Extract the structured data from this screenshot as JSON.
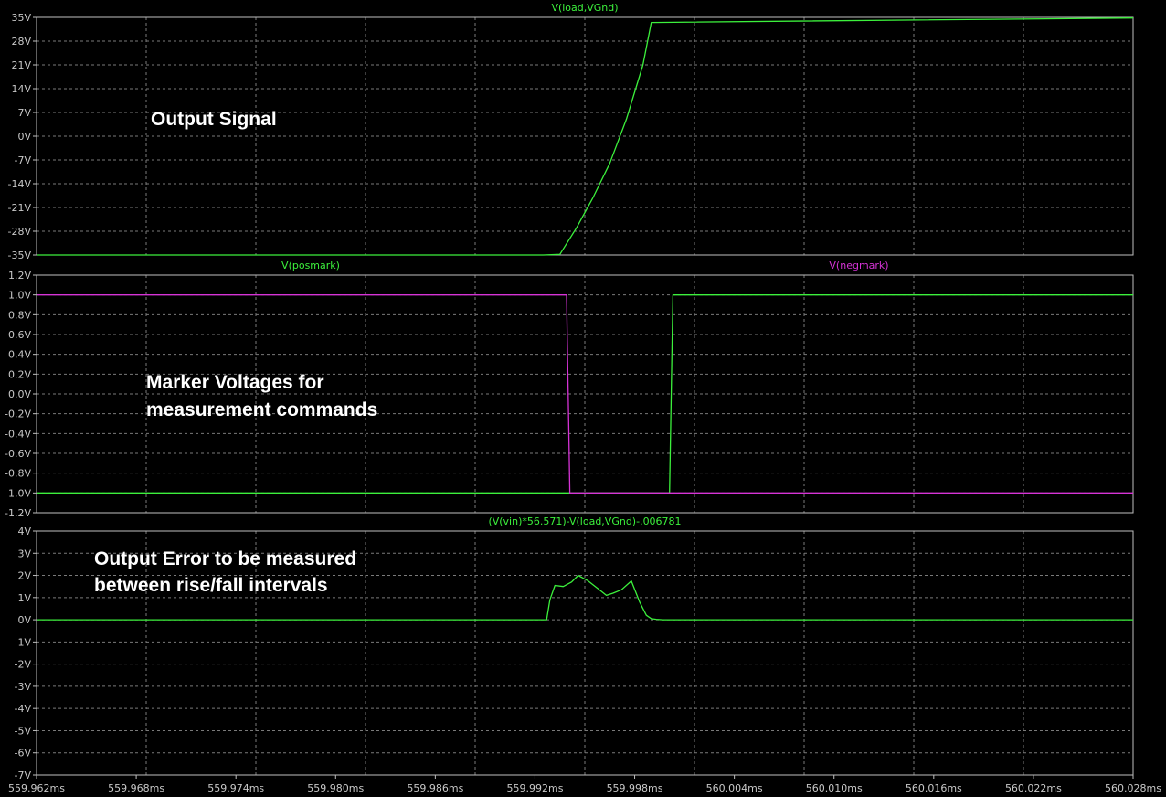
{
  "colors": {
    "background": "#000000",
    "frame": "#bfbfbf",
    "grid": "#7a7a7a",
    "tick_text": "#c8c8c8",
    "green": "#3cf03c",
    "magenta": "#d633d6",
    "annotation": "#ffffff"
  },
  "chart_data": [
    {
      "type": "line",
      "title": "V(load,VGnd)",
      "grid": true,
      "xlim": [
        559.962,
        560.028
      ],
      "ylim": [
        -35,
        35
      ],
      "yticks": [
        "35V",
        "28V",
        "21V",
        "14V",
        "7V",
        "0V",
        "-7V",
        "-14V",
        "-21V",
        "-28V",
        "-35V"
      ],
      "annotation": "Output Signal",
      "series": [
        {
          "name": "V(load,VGnd)",
          "color": "green",
          "x": [
            559.962,
            559.9925,
            559.9935,
            559.9945,
            559.9955,
            559.9965,
            559.9975,
            559.9985,
            559.999,
            560.028
          ],
          "y": [
            -35,
            -35,
            -34.8,
            -27,
            -18,
            -8,
            5,
            21,
            33.5,
            34.8
          ]
        }
      ]
    },
    {
      "type": "line",
      "grid": true,
      "xlim": [
        559.962,
        560.028
      ],
      "ylim": [
        -1.2,
        1.2
      ],
      "yticks": [
        "1.2V",
        "1.0V",
        "0.8V",
        "0.6V",
        "0.4V",
        "0.2V",
        "0.0V",
        "-0.2V",
        "-0.4V",
        "-0.6V",
        "-0.8V",
        "-1.0V",
        "-1.2V"
      ],
      "annotation": "Marker Voltages for measurement commands",
      "series": [
        {
          "name": "V(posmark)",
          "color": "green",
          "x": [
            559.962,
            560.0001,
            560.0003,
            560.028
          ],
          "y": [
            -1.0,
            -1.0,
            1.0,
            1.0
          ]
        },
        {
          "name": "V(negmark)",
          "color": "magenta",
          "x": [
            559.962,
            559.9939,
            559.9941,
            560.028
          ],
          "y": [
            1.0,
            1.0,
            -1.0,
            -1.0
          ]
        }
      ]
    },
    {
      "type": "line",
      "title": "(V(vin)*56.571)-V(load,VGnd)-.006781",
      "grid": true,
      "xlim": [
        559.962,
        560.028
      ],
      "ylim": [
        -7,
        4
      ],
      "yticks": [
        "4V",
        "3V",
        "2V",
        "1V",
        "0V",
        "-1V",
        "-2V",
        "-3V",
        "-4V",
        "-5V",
        "-6V",
        "-7V"
      ],
      "xticks": [
        "559.962ms",
        "559.968ms",
        "559.974ms",
        "559.980ms",
        "559.986ms",
        "559.992ms",
        "559.998ms",
        "560.004ms",
        "560.010ms",
        "560.016ms",
        "560.022ms",
        "560.028ms"
      ],
      "xlabel": "",
      "annotation": "Output Error to be measured between rise/fall intervals",
      "series": [
        {
          "name": "(V(vin)*56.571)-V(load,VGnd)-.006781",
          "color": "green",
          "x": [
            559.962,
            559.9927,
            559.9929,
            559.9932,
            559.9937,
            559.9942,
            559.9946,
            559.9952,
            559.9958,
            559.9963,
            559.9967,
            559.9972,
            559.9978,
            559.9983,
            559.9987,
            559.999,
            559.9993,
            559.9997,
            560.0002,
            560.028
          ],
          "y": [
            0,
            0,
            0.9,
            1.55,
            1.5,
            1.7,
            2.0,
            1.75,
            1.4,
            1.1,
            1.2,
            1.35,
            1.75,
            0.8,
            0.2,
            0.05,
            0.02,
            0.0,
            0.0,
            0.0
          ]
        }
      ]
    }
  ]
}
